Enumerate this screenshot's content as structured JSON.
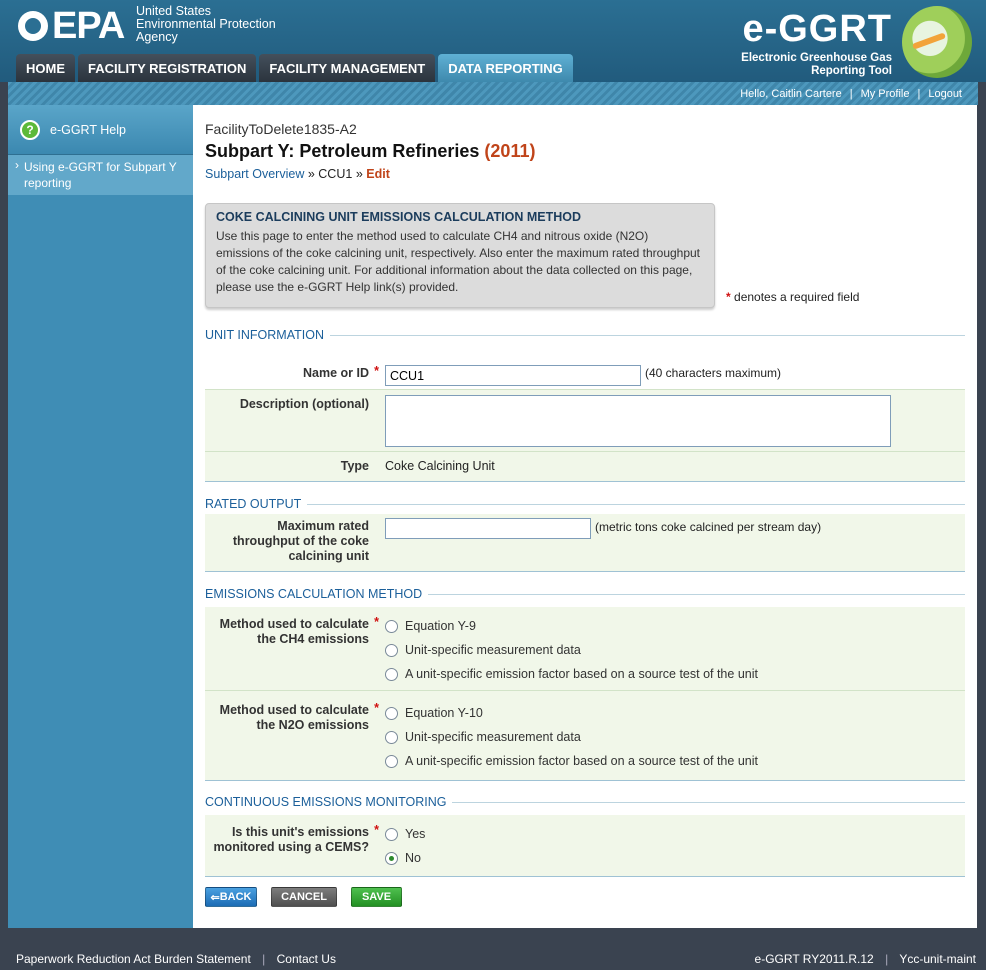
{
  "header": {
    "agency_lines": [
      "United States",
      "Environmental Protection",
      "Agency"
    ],
    "brand_title": "e-GGRT",
    "brand_sub_lines": [
      "Electronic Greenhouse Gas",
      "Reporting Tool"
    ]
  },
  "nav": {
    "tabs": [
      {
        "label": "HOME"
      },
      {
        "label": "FACILITY REGISTRATION"
      },
      {
        "label": "FACILITY MANAGEMENT"
      },
      {
        "label": "DATA REPORTING"
      }
    ]
  },
  "userbar": {
    "greeting": "Hello, Caitlin Cartere",
    "profile": "My Profile",
    "logout": "Logout",
    "sep": "|"
  },
  "sidebar": {
    "help_label": "e-GGRT Help",
    "help_link": "Using e-GGRT for Subpart Y reporting"
  },
  "page": {
    "facility": "FacilityToDelete1835-A2",
    "title": "Subpart Y: Petroleum Refineries",
    "year": "(2011)",
    "crumb_overview": "Subpart Overview",
    "crumb_sep1": "»",
    "crumb_unit": "CCU1",
    "crumb_sep2": "»",
    "crumb_edit": "Edit"
  },
  "info": {
    "heading": "COKE CALCINING UNIT EMISSIONS CALCULATION METHOD",
    "text": "Use this page to enter the method used to calculate CH4 and nitrous oxide (N2O) emissions of the coke calcining unit, respectively. Also enter the maximum rated throughput of the coke calcining unit. For additional information about the data collected on this page, please use the e-GGRT Help link(s) provided."
  },
  "required_note": "denotes a required field",
  "unit_info": {
    "section": "UNIT INFORMATION",
    "name_label": "Name or ID",
    "name_value": "CCU1",
    "name_hint": "(40 characters maximum)",
    "desc_label": "Description (optional)",
    "desc_value": "",
    "type_label": "Type",
    "type_value": "Coke Calcining Unit"
  },
  "rated_output": {
    "section": "RATED OUTPUT",
    "label": "Maximum rated throughput of the coke calcining unit",
    "value": "",
    "hint": "(metric tons coke calcined per stream day)"
  },
  "ecm": {
    "section": "EMISSIONS CALCULATION METHOD",
    "ch4_label": "Method used to calculate the CH4 emissions",
    "ch4_options": [
      "Equation Y-9",
      "Unit-specific measurement data",
      "A unit-specific emission factor based on a source test of the unit"
    ],
    "n2o_label": "Method used to calculate the N2O emissions",
    "n2o_options": [
      "Equation Y-10",
      "Unit-specific measurement data",
      "A unit-specific emission factor based on a source test of the unit"
    ]
  },
  "cem": {
    "section": "CONTINUOUS EMISSIONS MONITORING",
    "label": "Is this unit's emissions monitored using a CEMS?",
    "options": [
      "Yes",
      "No"
    ],
    "selected": "No"
  },
  "buttons": {
    "back": "BACK",
    "cancel": "CANCEL",
    "save": "SAVE"
  },
  "footer": {
    "paperwork": "Paperwork Reduction Act Burden Statement",
    "contact": "Contact Us",
    "version": "e-GGRT RY2011.R.12",
    "server": "Ycc-unit-maint",
    "sep": "|"
  }
}
